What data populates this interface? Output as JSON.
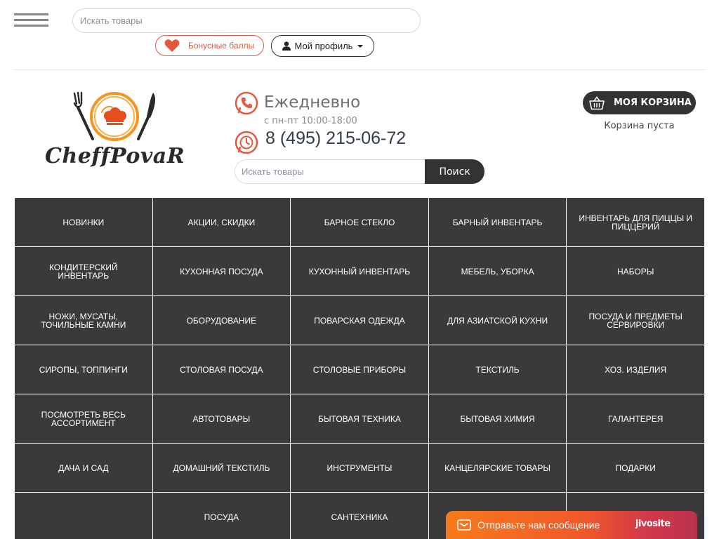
{
  "topbar": {
    "search_placeholder": "Искать товары",
    "bonus_label": "Бонусные баллы",
    "profile_label": "Мой профиль"
  },
  "header": {
    "logo_text": "CheffPovaR",
    "daily": "Ежедневно",
    "hours": "с пн-пт 10:00-18:00",
    "phone": "8 (495) 215-06-72",
    "search_placeholder": "Искать товары",
    "search_button": "Поиск",
    "cart_label": "МОЯ КОРЗИНА",
    "cart_status": "Корзина пуста"
  },
  "categories": [
    "НОВИНКИ",
    "АКЦИИ, СКИДКИ",
    "БАРНОЕ СТЕКЛО",
    "БАРНЫЙ ИНВЕНТАРЬ",
    "ИНВЕНТАРЬ ДЛЯ ПИЦЦЫ И ПИЦЦЕРИЙ",
    "КОНДИТЕРСКИЙ ИНВЕНТАРЬ",
    "КУХОННАЯ ПОСУДА",
    "КУХОННЫЙ ИНВЕНТАРЬ",
    "МЕБЕЛЬ, УБОРКА",
    "НАБОРЫ",
    "НОЖИ, МУСАТЫ, ТОЧИЛЬНЫЕ КАМНИ",
    "ОБОРУДОВАНИЕ",
    "ПОВАРСКАЯ ОДЕЖДА",
    "ДЛЯ АЗИАТСКОЙ КУХНИ",
    "ПОСУДА И ПРЕДМЕТЫ СЕРВИРОВКИ",
    "СИРОПЫ, ТОППИНГИ",
    "СТОЛОВАЯ ПОСУДА",
    "СТОЛОВЫЕ ПРИБОРЫ",
    "ТЕКСТИЛЬ",
    "ХОЗ. ИЗДЕЛИЯ",
    "ПОСМОТРЕТЬ ВЕСЬ АССОРТИМЕНТ",
    "АВТОТОВАРЫ",
    "БЫТОВАЯ ТЕХНИКА",
    "БЫТОВАЯ ХИМИЯ",
    "ГАЛАНТЕРЕЯ",
    "ДАЧА И САД",
    "ДОМАШНИЙ ТЕКСТИЛЬ",
    "ИНСТРУМЕНТЫ",
    "КАНЦЕЛЯРСКИЕ ТОВАРЫ",
    "ПОДАРКИ",
    "",
    "ПОСУДА",
    "САНТЕХНИКА",
    "",
    ""
  ],
  "chat": {
    "message": "Отправьте нам сообщение",
    "brand": "jivosite"
  },
  "colors": {
    "accent": "#e2593d",
    "dark": "#3a3a3c",
    "chat_gradient_start": "#f77a1c",
    "chat_gradient_end": "#b9334e"
  }
}
